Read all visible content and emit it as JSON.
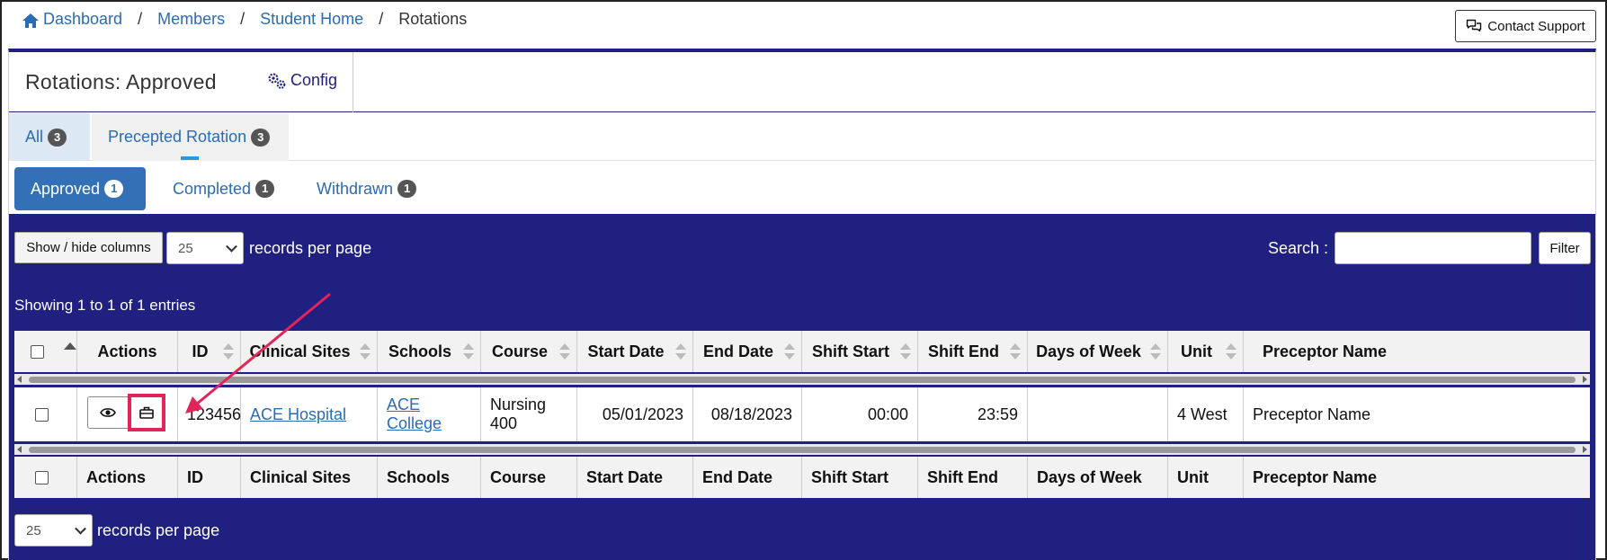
{
  "breadcrumb": {
    "items": [
      "Dashboard",
      "Members",
      "Student Home"
    ],
    "current": "Rotations",
    "separator": "/"
  },
  "contact_support": "Contact Support",
  "header": {
    "title": "Rotations: Approved",
    "config_label": "Config"
  },
  "tabs": [
    {
      "label": "All",
      "count": "3"
    },
    {
      "label": "Precepted Rotation",
      "count": "3"
    }
  ],
  "status_pills": [
    {
      "label": "Approved",
      "count": "1"
    },
    {
      "label": "Completed",
      "count": "1"
    },
    {
      "label": "Withdrawn",
      "count": "1"
    }
  ],
  "toolbar": {
    "show_hide": "Show / hide columns",
    "per_page_value": "25",
    "records_per_page": "records per page",
    "search_label": "Search :",
    "search_value": "",
    "filter_label": "Filter"
  },
  "showing_text": "Showing 1 to 1 of 1 entries",
  "table": {
    "columns": [
      "Actions",
      "ID",
      "Clinical Sites",
      "Schools",
      "Course",
      "Start Date",
      "End Date",
      "Shift Start",
      "Shift End",
      "Days of Week",
      "Unit",
      "Preceptor Name"
    ],
    "rows": [
      {
        "id": "123456",
        "clinical_site": "ACE Hospital",
        "school": "ACE College",
        "course": "Nursing 400",
        "start_date": "05/01/2023",
        "end_date": "08/18/2023",
        "shift_start": "00:00",
        "shift_end": "23:59",
        "days_of_week": "",
        "unit": "4 West",
        "preceptor_name": "Preceptor Name"
      }
    ]
  },
  "footer": {
    "per_page_value": "25",
    "records_per_page": "records per page"
  },
  "colors": {
    "table_bg": "#1f2080",
    "link": "#2a6bb5",
    "active_pill": "#3470b5",
    "highlight": "#e3245a"
  }
}
